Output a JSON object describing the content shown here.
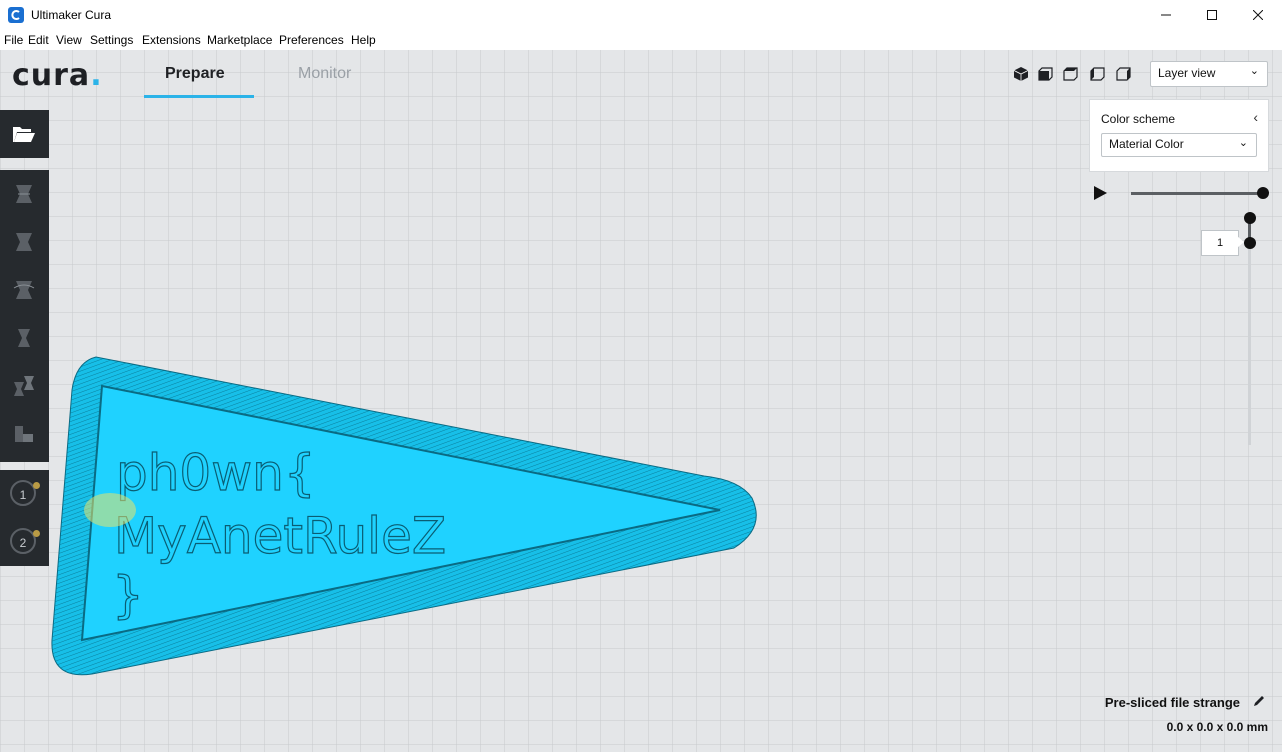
{
  "window": {
    "title": "Ultimaker Cura",
    "controls": [
      "minimize-icon",
      "maximize-icon",
      "close-icon"
    ]
  },
  "menu": {
    "items": [
      "File",
      "Edit",
      "View",
      "Settings",
      "Extensions",
      "Marketplace",
      "Preferences",
      "Help"
    ]
  },
  "header": {
    "logo_text": "cura",
    "logo_dot": ".",
    "tabs": [
      {
        "label": "Prepare",
        "active": true
      },
      {
        "label": "Monitor",
        "active": false
      }
    ],
    "view_buttons": [
      "3d-view-icon",
      "front-view-icon",
      "top-view-icon",
      "left-view-icon",
      "right-view-icon"
    ],
    "view_select": "Layer view"
  },
  "color_panel": {
    "title": "Color scheme",
    "selected": "Material Color"
  },
  "layer_slider": {
    "current_layer": "1"
  },
  "toolbar": {
    "tools": [
      "open-file-icon",
      "move-tool-icon",
      "scale-tool-icon",
      "rotate-tool-icon",
      "mirror-tool-icon",
      "per-model-settings-icon",
      "support-blocker-icon"
    ],
    "extruders": [
      "1",
      "2"
    ]
  },
  "model": {
    "text_lines": [
      "ph0wn{",
      "MyAnetRuleZ",
      "}"
    ],
    "color": "#1fd2ff"
  },
  "status": {
    "title": "Pre-sliced file strange",
    "dimensions": "0.0 x 0.0 x 0.0 mm"
  },
  "colors": {
    "accent": "#2bb3e8",
    "toolbar": "#262a2e",
    "grid_background": "#e4e6e8",
    "model_fill": "#1fd2ff"
  }
}
